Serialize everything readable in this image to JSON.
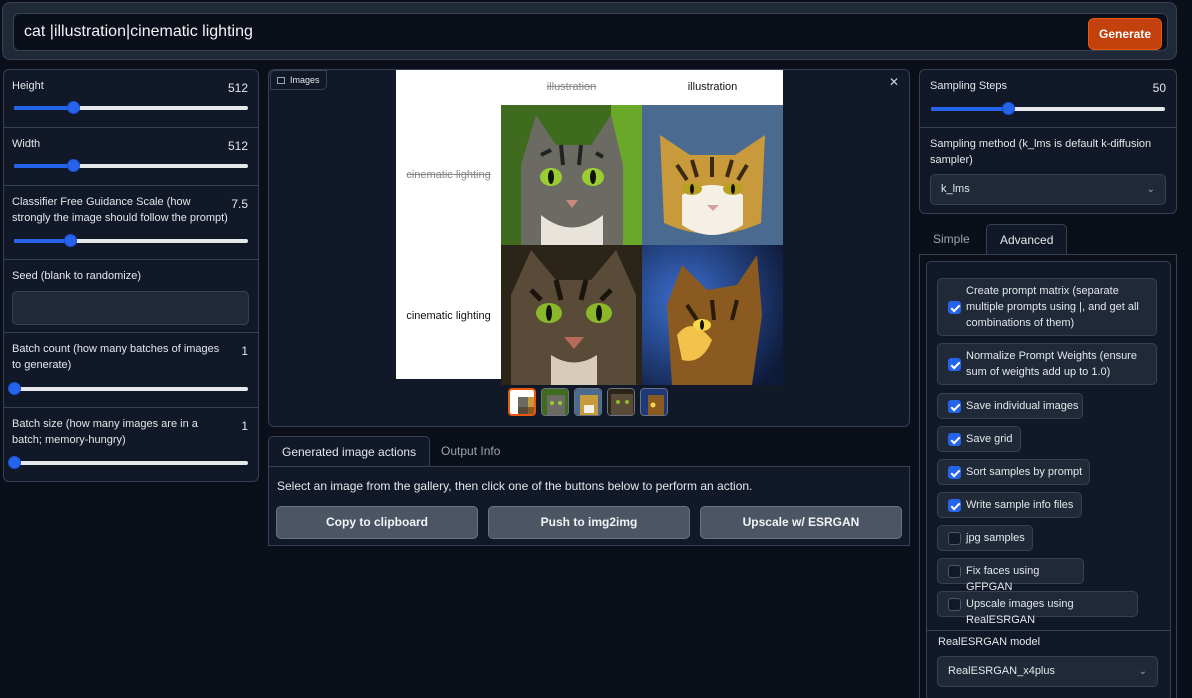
{
  "prompt": {
    "value": "cat |illustration|cinematic lighting",
    "generate_label": "Generate"
  },
  "left_panel": {
    "height": {
      "label": "Height",
      "value": "512",
      "fraction": 0.25
    },
    "width": {
      "label": "Width",
      "value": "512",
      "fraction": 0.25
    },
    "cfg": {
      "label": "Classifier Free Guidance Scale (how strongly the image should follow the prompt)",
      "value": "7.5",
      "fraction": 0.24
    },
    "seed": {
      "label": "Seed (blank to randomize)",
      "value": ""
    },
    "batch_count": {
      "label": "Batch count (how many batches of images to generate)",
      "value": "1",
      "fraction": 0.0
    },
    "batch_size": {
      "label": "Batch size (how many images are in a batch; memory-hungry)",
      "value": "1",
      "fraction": 0.0
    }
  },
  "gallery": {
    "tag": "Images",
    "col_labels": [
      "illustration",
      "illustration"
    ],
    "row_labels": [
      "cinematic lighting",
      "cinematic lighting"
    ],
    "thumb_count": 5,
    "active_thumb": 0
  },
  "actions": {
    "tabs": [
      "Generated image actions",
      "Output Info"
    ],
    "message": "Select an image from the gallery, then click one of the buttons below to perform an action.",
    "buttons": [
      "Copy to clipboard",
      "Push to img2img",
      "Upscale w/ ESRGAN"
    ]
  },
  "right_panel": {
    "steps": {
      "label": "Sampling Steps",
      "value": "50",
      "fraction": 0.33
    },
    "sampler": {
      "label": "Sampling method (k_lms is default k-diffusion sampler)",
      "value": "k_lms"
    },
    "tabs": [
      "Simple",
      "Advanced"
    ],
    "checkboxes": [
      {
        "label": "Create prompt matrix (separate multiple prompts using |, and get all combinations of them)",
        "checked": true
      },
      {
        "label": "Normalize Prompt Weights (ensure sum of weights add up to 1.0)",
        "checked": true
      },
      {
        "label": "Save individual images",
        "checked": true
      },
      {
        "label": "Save grid",
        "checked": true
      },
      {
        "label": "Sort samples by prompt",
        "checked": true
      },
      {
        "label": "Write sample info files",
        "checked": true
      },
      {
        "label": "jpg samples",
        "checked": false
      },
      {
        "label": "Fix faces using GFPGAN",
        "checked": false
      },
      {
        "label": "Upscale images using RealESRGAN",
        "checked": false
      }
    ],
    "esrgan": {
      "label": "RealESRGAN model",
      "value": "RealESRGAN_x4plus"
    }
  }
}
